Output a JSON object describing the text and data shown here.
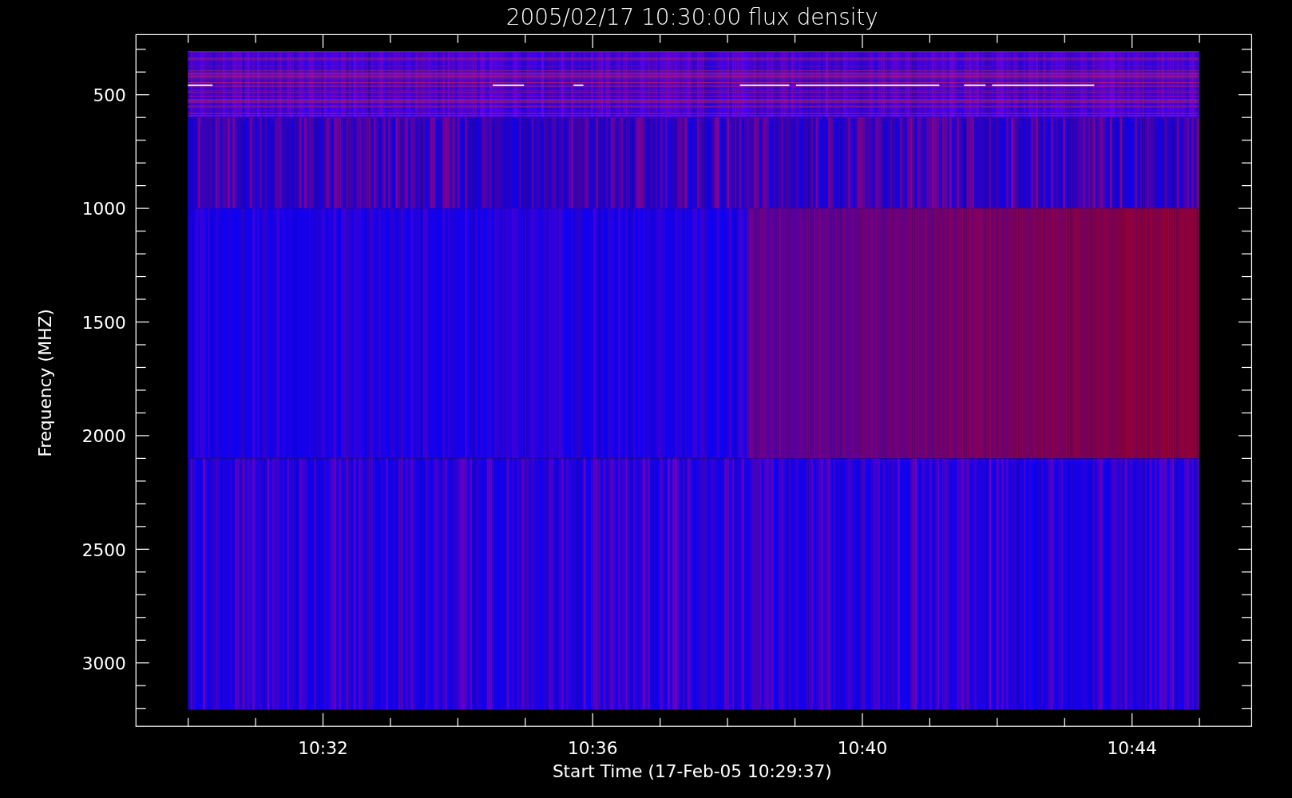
{
  "plot": {
    "title": "2005/02/17 10:30:00 flux density",
    "y_axis": {
      "label": "Frequency (MHZ)",
      "ticks": [
        "500",
        "1000",
        "1500",
        "2000",
        "2500",
        "3000"
      ]
    },
    "x_axis": {
      "label": "Start Time (17-Feb-05 10:29:37)",
      "ticks": [
        "10:32",
        "10:36",
        "10:40",
        "10:44"
      ]
    }
  }
}
